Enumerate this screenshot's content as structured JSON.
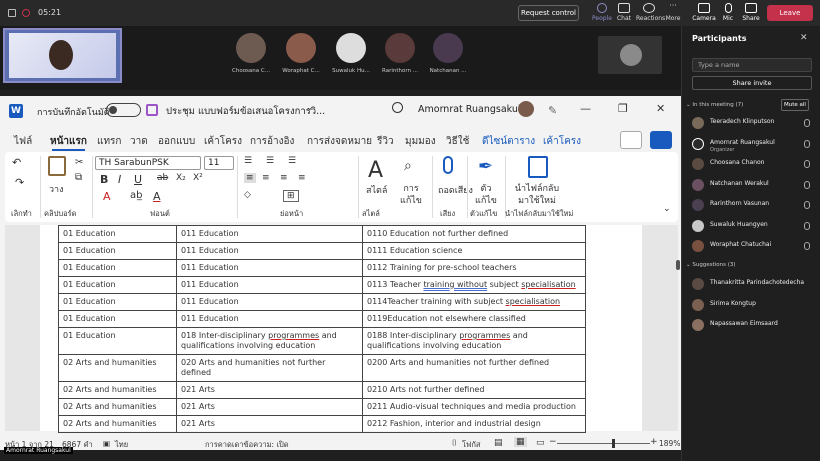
{
  "teams": {
    "timer": "05:21",
    "request_control": "Request control",
    "toolbar": [
      {
        "label": "People",
        "icon": "people-icon"
      },
      {
        "label": "Chat",
        "icon": "chat-icon"
      },
      {
        "label": "Reactions",
        "icon": "reactions-icon"
      },
      {
        "label": "More",
        "icon": "more-icon"
      },
      {
        "label": "Camera",
        "icon": "camera-icon"
      },
      {
        "label": "Mic",
        "icon": "mic-icon"
      },
      {
        "label": "Share",
        "icon": "share-icon"
      }
    ],
    "leave": "Leave",
    "video_tiles": [
      "Choosana C...",
      "Woraphat C...",
      "Suwaluk Hu...",
      "Rarinthorn ...",
      "Natchanan ..."
    ],
    "presenter_label": "Amornrat Ruangsakul"
  },
  "word": {
    "autosave_label": "การบันทึกอัตโนมัติ",
    "doc_title": "ประชุม แบบฟอร์มข้อเสนอโครงการวิ...",
    "user_name": "Amornrat Ruangsakul",
    "tabs": [
      "ไฟล์",
      "หน้าแรก",
      "แทรก",
      "วาด",
      "ออกแบบ",
      "เค้าโครง",
      "การอ้างอิง",
      "การส่งจดหมาย",
      "รีวิว",
      "มุมมอง",
      "วิธีใช้",
      "ดีไซน์ตาราง",
      "เค้าโครง"
    ],
    "ribbon": {
      "font_name": "TH SarabunPSK",
      "font_size": "11",
      "paste_label": "วาง",
      "styles_label": "สไตล์",
      "editing_label": "การแก้ไข",
      "dictate_label": "ถอดเสียง",
      "editor_label": "ตัวแก้ไข",
      "reuse_label": "นำไฟล์กลับมาใช้ใหม่",
      "groups": [
        "เลิกทำ",
        "คลิปบอร์ด",
        "ฟอนต์",
        "ย่อหน้า",
        "สไตล์",
        "เสียง",
        "ตัวแก้ไข",
        "นำไฟล์กลับมาใช้ใหม่"
      ]
    },
    "table_rows": [
      [
        "01 Education",
        "011 Education",
        "0110 Education not further defined"
      ],
      [
        "01 Education",
        "011 Education",
        "0111 Education science"
      ],
      [
        "01 Education",
        "011 Education",
        "0112 Training for pre-school teachers"
      ],
      [
        "01 Education",
        "011 Education",
        "0113 Teacher training without subject specialisation"
      ],
      [
        "01 Education",
        "011 Education",
        "0114Teacher training with subject specialisation"
      ],
      [
        "01 Education",
        "011 Education",
        "0119Education not elsewhere classified"
      ],
      [
        "01 Education",
        "018 Inter-disciplinary programmes and qualifications involving education",
        "0188 Inter-disciplinary programmes and qualifications involving education"
      ],
      [
        "02 Arts and humanities",
        "020 Arts and humanities not further defined",
        "0200 Arts and humanities not further defined"
      ],
      [
        "02 Arts and humanities",
        "021 Arts",
        "0210 Arts not further defined"
      ],
      [
        "02 Arts and humanities",
        "021 Arts",
        "0211 Audio-visual techniques and media production"
      ],
      [
        "02 Arts and humanities",
        "021 Arts",
        "0212 Fashion, interior and industrial design"
      ]
    ],
    "status": {
      "page": "หน้า 1 จาก 21",
      "words": "6867 คำ",
      "language": "ไทย",
      "predictions": "การคาดเดาข้อความ: เปิด",
      "focus": "โฟกัส",
      "zoom": "189%"
    }
  },
  "participants": {
    "title": "Participants",
    "search_placeholder": "Type a name",
    "share_invite": "Share invite",
    "in_meeting_header": "In this meeting (7)",
    "mute_all": "Mute all",
    "in_meeting": [
      {
        "name": "Teeradech Klinputson",
        "role": ""
      },
      {
        "name": "Amornrat Ruangsakul",
        "role": "Organizer"
      },
      {
        "name": "Choosana Chanon",
        "role": ""
      },
      {
        "name": "Natchanan Werakul",
        "role": ""
      },
      {
        "name": "Rarinthorn Vasunan",
        "role": ""
      },
      {
        "name": "Suwaluk Huangyen",
        "role": ""
      },
      {
        "name": "Woraphat Chatuchai",
        "role": ""
      }
    ],
    "suggestions_header": "Suggestions (3)",
    "suggestions": [
      {
        "name": "Thanakritta Parindachotedecha"
      },
      {
        "name": "Sirima Kongtup"
      },
      {
        "name": "Napassawan Eimsaard"
      }
    ]
  }
}
